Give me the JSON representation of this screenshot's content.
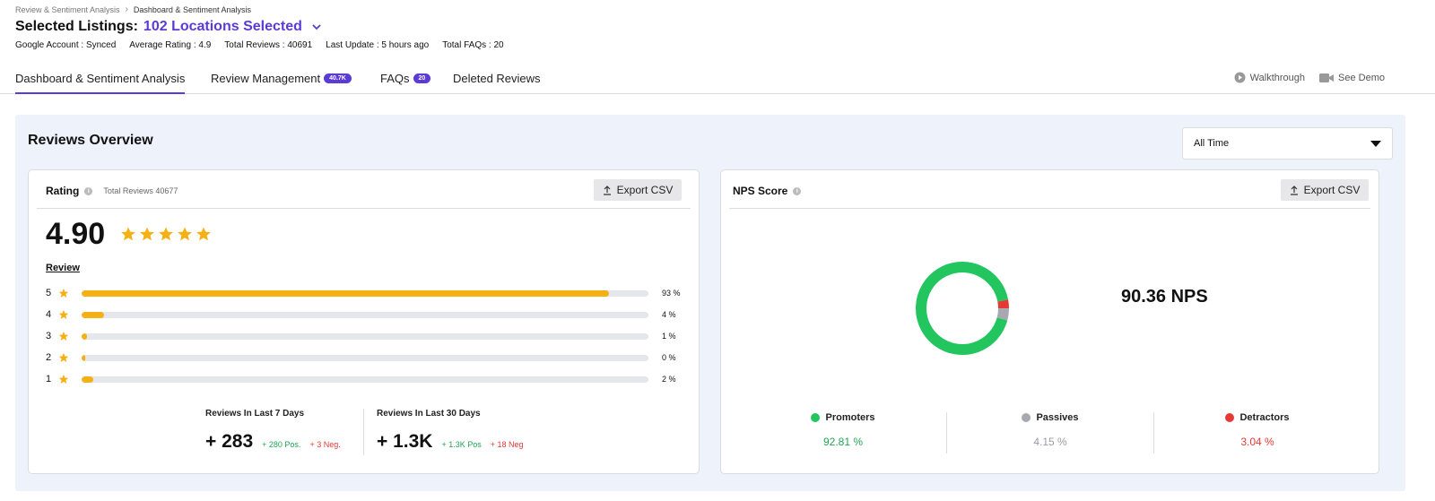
{
  "breadcrumb": {
    "parent": "Review & Sentiment Analysis",
    "current": "Dashboard & Sentiment Analysis"
  },
  "header": {
    "title_prefix": "Selected Listings:",
    "title_value": "102 Locations Selected",
    "meta": [
      "Google Account : Synced",
      "Average Rating : 4.9",
      "Total Reviews : 40691",
      "Last Update : 5 hours ago",
      "Total FAQs : 20"
    ]
  },
  "tabs": [
    {
      "label": "Dashboard & Sentiment Analysis",
      "active": true
    },
    {
      "label": "Review Management",
      "badge": "40.7K"
    },
    {
      "label": "FAQs",
      "badge": "20"
    },
    {
      "label": "Deleted Reviews"
    }
  ],
  "tools": {
    "walkthrough": "Walkthrough",
    "demo": "See Demo"
  },
  "overview": {
    "title": "Reviews Overview",
    "filter": "All Time"
  },
  "rating_card": {
    "title": "Rating",
    "total": "Total Reviews 40677",
    "export": "Export CSV",
    "value": "4.90",
    "review_label": "Review",
    "bars": [
      {
        "star": "5",
        "pct_label": "93 %",
        "fraction": 0.93
      },
      {
        "star": "4",
        "pct_label": "4 %",
        "fraction": 0.04
      },
      {
        "star": "3",
        "pct_label": "1 %",
        "fraction": 0.01
      },
      {
        "star": "2",
        "pct_label": "0 %",
        "fraction": 0.003
      },
      {
        "star": "1",
        "pct_label": "2 %",
        "fraction": 0.02
      }
    ],
    "last7": {
      "label": "Reviews In Last 7 Days",
      "value": "+ 283",
      "pos": "+ 280 Pos.",
      "neg": "+ 3 Neg."
    },
    "last30": {
      "label": "Reviews In Last 30 Days",
      "value": "+ 1.3K",
      "pos": "+ 1.3K Pos",
      "neg": "+ 18 Neg"
    }
  },
  "nps_card": {
    "title": "NPS Score",
    "export": "Export CSV",
    "value": "90.36 NPS",
    "segments": [
      {
        "name": "Promoters",
        "value": "92.81 %",
        "fraction": 0.9281,
        "color": "#22c55e",
        "text_color": "#22a453"
      },
      {
        "name": "Passives",
        "value": "4.15 %",
        "fraction": 0.0415,
        "color": "#a7a9b0",
        "text_color": "#9a9ca3"
      },
      {
        "name": "Detractors",
        "value": "3.04 %",
        "fraction": 0.0304,
        "color": "#e53935",
        "text_color": "#e53935"
      }
    ]
  },
  "colors": {
    "accent": "#5b3bd6",
    "star": "#f5b014"
  }
}
